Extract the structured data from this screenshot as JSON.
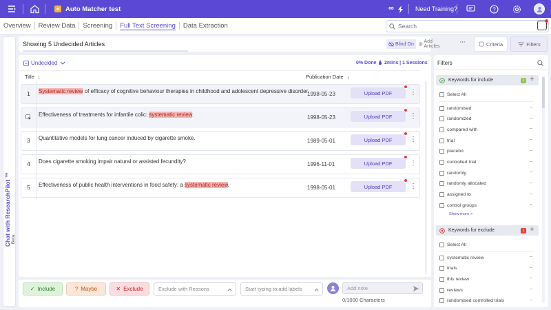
{
  "topbar": {
    "project_title": "Auto Matcher test",
    "training_label": "Need Training?",
    "infinity_icon": "∞"
  },
  "nav": {
    "tabs": [
      "Overview",
      "Review Data",
      "Screening",
      "Full Text Screening",
      "Data Extraction"
    ],
    "active_index": 3,
    "search_placeholder": "Search"
  },
  "sidechat": {
    "label": "Chat with ResearchPilot ™",
    "beta": "Beta"
  },
  "header": {
    "showing": "Showing 5 Undecided Articles",
    "blind_on": "Blind On",
    "add_articles": "Add Articles",
    "criteria": "Criteria",
    "filters": "Filters"
  },
  "status": {
    "filter_label": "Undecided",
    "progress": "0% Done",
    "time": "2mins | 1 Sessions"
  },
  "table": {
    "col_title": "Title",
    "col_date": "Publication Date",
    "upload_label": "Upload PDF",
    "rows": [
      {
        "num": "1",
        "pre": "",
        "mark": "Systematic review",
        "post": " of efficacy of cognitive behaviour therapies in childhood and adolescent depressive disorder.",
        "date": "1998-05-23",
        "highlight": true,
        "icon": false
      },
      {
        "num": "",
        "pre": "Effectiveness of treatments for infantile colic: ",
        "mark": "systematic review",
        "post": ".",
        "date": "1998-05-23",
        "highlight": true,
        "icon": true
      },
      {
        "num": "3",
        "pre": "Quantitative models for lung cancer induced by cigarette smoke.",
        "mark": "",
        "post": "",
        "date": "1989-05-01",
        "highlight": false,
        "icon": false
      },
      {
        "num": "4",
        "pre": "Does cigarette smoking impair natural or assisted fecundity?",
        "mark": "",
        "post": "",
        "date": "1996-11-01",
        "highlight": false,
        "icon": false
      },
      {
        "num": "5",
        "pre": "Effectiveness of public health interventions in food safety: a ",
        "mark": "systematic review",
        "post": ".",
        "date": "1998-05-01",
        "highlight": false,
        "icon": false
      }
    ]
  },
  "actions": {
    "include": "Include",
    "maybe": "Maybe",
    "exclude": "Exclude",
    "exclude_reasons_placeholder": "Exclude with Reasons",
    "labels_placeholder": "Start typing to add labels",
    "note_placeholder": "Add note",
    "char_count": "0/1000 Characters"
  },
  "filters": {
    "title": "Filters",
    "include_group": "Keywords for include",
    "include_badge": "1",
    "exclude_group": "Keywords for exclude",
    "exclude_badge": "1",
    "select_all": "Select All",
    "include_items": [
      "randomised",
      "randomized",
      "compared with",
      "trial",
      "placebo",
      "controlled trial",
      "randomly",
      "randomly allocated",
      "assigned to",
      "control groups"
    ],
    "show_more": "Show more >",
    "exclude_items": [
      "systematic review",
      "trials",
      "this review",
      "reviews",
      "randomised controlled trials"
    ],
    "dash": "–"
  },
  "colors": {
    "accent": "#5b49d6",
    "highlight": "#f3b7b3",
    "include_bg": "#dff2dc",
    "maybe_bg": "#fbe6da",
    "exclude_bg": "#fbdde0"
  }
}
